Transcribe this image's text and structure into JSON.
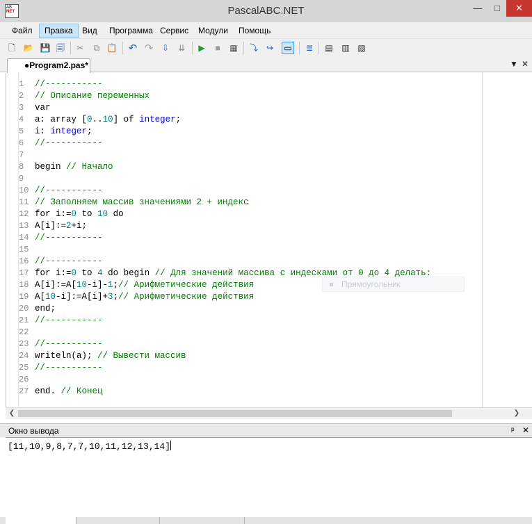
{
  "window": {
    "title": "PascalABC.NET",
    "icon_letters": [
      "AB",
      "NET"
    ],
    "min": "—",
    "max": "□",
    "close": "✕"
  },
  "menu": [
    {
      "label": "Файл"
    },
    {
      "label": "Правка"
    },
    {
      "label": "Вид"
    },
    {
      "label": "Программа"
    },
    {
      "label": "Сервис"
    },
    {
      "label": "Модули"
    },
    {
      "label": "Помощь"
    }
  ],
  "toolbar": [
    {
      "name": "new-file-icon",
      "glyph": "🗋"
    },
    {
      "name": "open-folder-icon",
      "glyph": "📂"
    },
    {
      "name": "save-icon",
      "glyph": "💾"
    },
    {
      "name": "save-all-icon",
      "glyph": "🗐"
    },
    {
      "name": "cut-icon",
      "glyph": "✂"
    },
    {
      "name": "copy-icon",
      "glyph": "⧉"
    },
    {
      "name": "paste-icon",
      "glyph": "📋"
    },
    {
      "name": "undo-icon",
      "glyph": "↶"
    },
    {
      "name": "redo-icon",
      "glyph": "↷"
    },
    {
      "name": "compile-icon",
      "glyph": "⇩"
    },
    {
      "name": "compile-all-icon",
      "glyph": "⇊"
    },
    {
      "name": "run-icon",
      "glyph": "▶"
    },
    {
      "name": "stop-icon",
      "glyph": "■"
    },
    {
      "name": "debug-icon",
      "glyph": "▦"
    },
    {
      "name": "step-into-icon",
      "glyph": "⤵"
    },
    {
      "name": "step-over-icon",
      "glyph": "↪"
    },
    {
      "name": "output-window-icon",
      "glyph": "▭"
    },
    {
      "name": "format-code-icon",
      "glyph": "≣"
    },
    {
      "name": "form-designer-icon",
      "glyph": "▤"
    },
    {
      "name": "form-events-icon",
      "glyph": "▥"
    },
    {
      "name": "form-reports-icon",
      "glyph": "▧"
    }
  ],
  "tab": {
    "label": "●Program2.pas*",
    "dropdown": "▼",
    "close": "✕"
  },
  "code_lines": [
    {
      "n": "1",
      "tokens": [
        [
          "cm",
          "//-----------"
        ]
      ]
    },
    {
      "n": "2",
      "tokens": [
        [
          "cm",
          "// Описание переменных"
        ]
      ]
    },
    {
      "n": "3",
      "tokens": [
        [
          "kw",
          "var"
        ]
      ]
    },
    {
      "n": "4",
      "tokens": [
        [
          "id",
          "a: "
        ],
        [
          "kw",
          "array "
        ],
        [
          "id",
          "["
        ],
        [
          "num",
          "0"
        ],
        [
          "id",
          ".."
        ],
        [
          "num",
          "10"
        ],
        [
          "id",
          "] "
        ],
        [
          "kw",
          "of "
        ],
        [
          "type",
          "integer"
        ],
        [
          "id",
          ";"
        ]
      ]
    },
    {
      "n": "5",
      "tokens": [
        [
          "id",
          "i: "
        ],
        [
          "type",
          "integer"
        ],
        [
          "id",
          ";"
        ]
      ]
    },
    {
      "n": "6",
      "tokens": [
        [
          "cm",
          "//-----------"
        ]
      ]
    },
    {
      "n": "7",
      "tokens": []
    },
    {
      "n": "8",
      "tokens": [
        [
          "kw",
          "begin "
        ],
        [
          "cm",
          "// Начало"
        ]
      ]
    },
    {
      "n": "9",
      "tokens": []
    },
    {
      "n": "10",
      "tokens": [
        [
          "cm",
          "//-----------"
        ]
      ]
    },
    {
      "n": "11",
      "tokens": [
        [
          "cm",
          "// Заполняем массив значениями 2 + индекс"
        ]
      ]
    },
    {
      "n": "12",
      "tokens": [
        [
          "kw",
          "for "
        ],
        [
          "id",
          "i:="
        ],
        [
          "num",
          "0"
        ],
        [
          "kw",
          " to "
        ],
        [
          "num",
          "10"
        ],
        [
          "kw",
          " do"
        ]
      ]
    },
    {
      "n": "13",
      "tokens": [
        [
          "id",
          "A[i]:="
        ],
        [
          "num",
          "2"
        ],
        [
          "id",
          "+i;"
        ]
      ]
    },
    {
      "n": "14",
      "tokens": [
        [
          "cm",
          "//-----------"
        ]
      ]
    },
    {
      "n": "15",
      "tokens": []
    },
    {
      "n": "16",
      "tokens": [
        [
          "cm",
          "//-----------"
        ]
      ]
    },
    {
      "n": "17",
      "tokens": [
        [
          "kw",
          "for "
        ],
        [
          "id",
          "i:="
        ],
        [
          "num",
          "0"
        ],
        [
          "kw",
          " to "
        ],
        [
          "num",
          "4"
        ],
        [
          "kw",
          " do begin "
        ],
        [
          "cm",
          "// Для значений массива с индесками от 0 до 4 делать:"
        ]
      ]
    },
    {
      "n": "18",
      "tokens": [
        [
          "id",
          "A[i]:=A["
        ],
        [
          "num",
          "10"
        ],
        [
          "id",
          "-i]-"
        ],
        [
          "num",
          "1"
        ],
        [
          "id",
          ";"
        ],
        [
          "cm",
          "// Арифметические действия"
        ]
      ]
    },
    {
      "n": "19",
      "tokens": [
        [
          "id",
          "A["
        ],
        [
          "num",
          "10"
        ],
        [
          "id",
          "-i]:=A[i]+"
        ],
        [
          "num",
          "3"
        ],
        [
          "id",
          ";"
        ],
        [
          "cm",
          "// Арифметические действия"
        ]
      ]
    },
    {
      "n": "20",
      "tokens": [
        [
          "kw",
          "end"
        ],
        [
          "id",
          ";"
        ]
      ]
    },
    {
      "n": "21",
      "tokens": [
        [
          "cm",
          "//-----------"
        ]
      ]
    },
    {
      "n": "22",
      "tokens": []
    },
    {
      "n": "23",
      "tokens": [
        [
          "cm",
          "//-----------"
        ]
      ]
    },
    {
      "n": "24",
      "tokens": [
        [
          "id",
          "writeln(a); "
        ],
        [
          "cm",
          "// Вывести массив"
        ]
      ]
    },
    {
      "n": "25",
      "tokens": [
        [
          "cm",
          "//-----------"
        ]
      ]
    },
    {
      "n": "26",
      "tokens": []
    },
    {
      "n": "27",
      "tokens": [
        [
          "kw",
          "end"
        ],
        [
          "id",
          ". "
        ],
        [
          "cm",
          "// Конец"
        ]
      ]
    }
  ],
  "ghost_tooltip": "Прямоугольник",
  "output": {
    "title": "Окно вывода",
    "pin": "ᵖ",
    "close": "✕",
    "text": "[11,10,9,8,7,7,10,11,12,13,14]"
  },
  "colors": {
    "keyword": "#000000",
    "comment": "#008000",
    "number": "#008080",
    "type": "#0000ff",
    "close_button": "#c7372f",
    "active_menu": "#cde6f7"
  }
}
